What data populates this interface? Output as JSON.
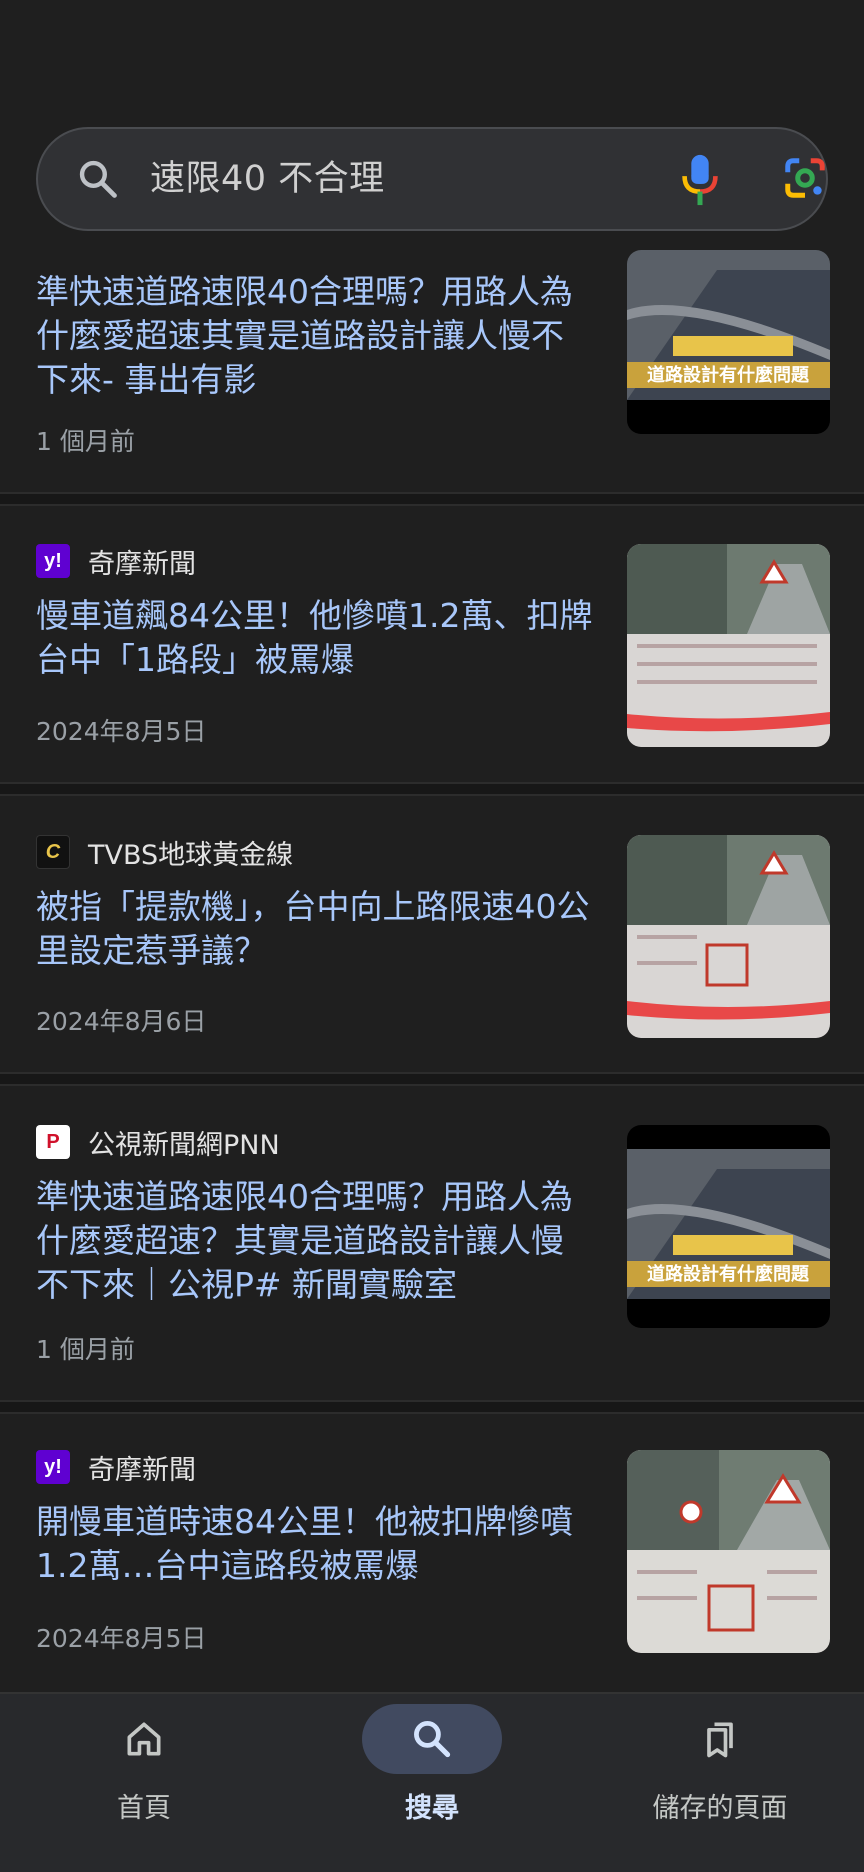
{
  "search": {
    "query": "速限40  不合理"
  },
  "results": [
    {
      "source": "",
      "title": "準快速道路速限40合理嗎？用路人為什麼愛超速其實是道路設計讓人慢不下來- 事出有影",
      "date": "1 個月前",
      "thumb_text": "道路設計有什麼問題"
    },
    {
      "source": "奇摩新聞",
      "favicon_text": "y!",
      "title": "慢車道飆84公里！他慘噴1.2萬、扣牌 台中「1路段」被罵爆",
      "date": "2024年8月5日"
    },
    {
      "source": "TVBS地球黃金線",
      "favicon_text": "C",
      "title": "被指「提款機」，台中向上路限速40公里設定惹爭議？",
      "date": "2024年8月6日"
    },
    {
      "source": "公視新聞網PNN",
      "favicon_text": "P",
      "title": "準快速道路速限40合理嗎？用路人為什麼愛超速？其實是道路設計讓人慢不下來｜公視P# 新聞實驗室",
      "date": "1 個月前",
      "thumb_text": "道路設計有什麼問題"
    },
    {
      "source": "奇摩新聞",
      "favicon_text": "y!",
      "title": "開慢車道時速84公里！他被扣牌慘噴1.2萬…台中這路段被罵爆",
      "date": "2024年8月5日"
    }
  ],
  "bottom_nav": {
    "home": "首頁",
    "search": "搜尋",
    "saved": "儲存的頁面"
  },
  "colors": {
    "background": "#1f1f1f",
    "link": "#a8c7fa",
    "active_pill": "#414a60"
  }
}
